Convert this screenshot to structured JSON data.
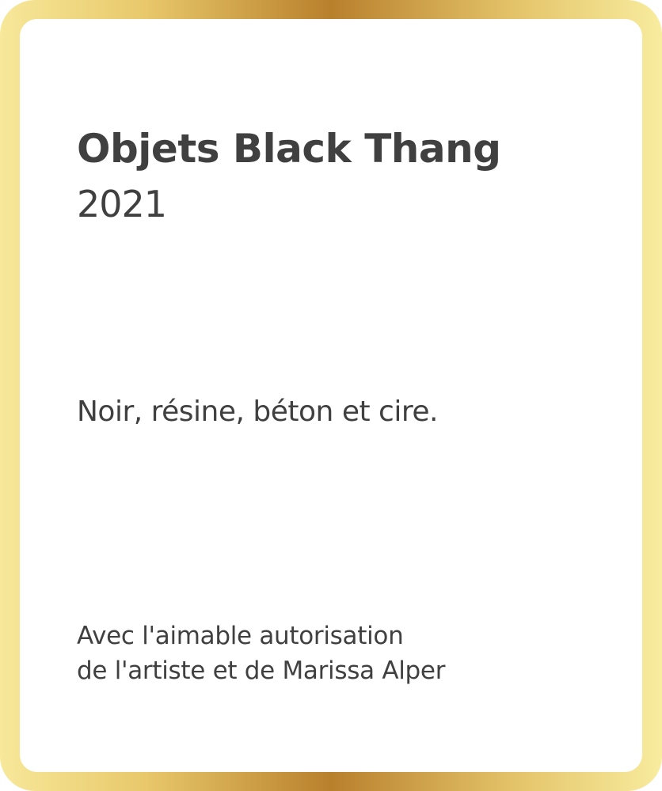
{
  "label": {
    "title": "Objets Black Thang",
    "year": "2021",
    "medium": "Noir, résine, béton et cire.",
    "credit_lines": [
      "Avec l'aimable autorisation",
      "de l'artiste et de Marissa Alper"
    ]
  },
  "colors": {
    "text": "#404040",
    "frame_gold_light": "#f7e89a",
    "frame_gold_dark": "#b9802c",
    "background": "#ffffff"
  }
}
